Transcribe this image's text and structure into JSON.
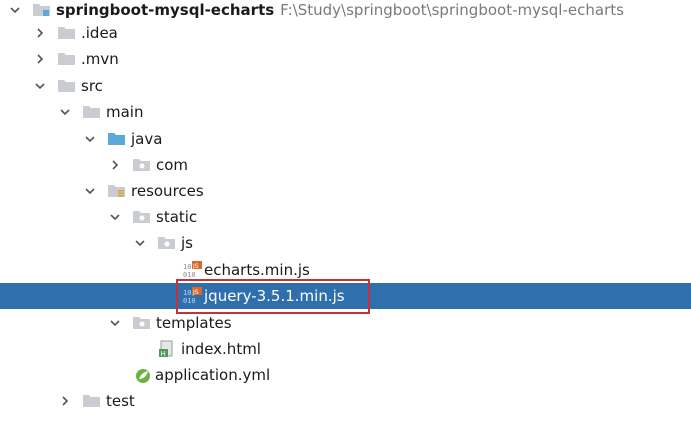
{
  "project_tree": {
    "root": {
      "name": "springboot-mysql-echarts",
      "path": "F:\\Study\\springboot\\springboot-mysql-echarts",
      "icon": "module-folder-icon",
      "expanded": true
    },
    "items": [
      {
        "label": "idea_folder",
        "name": ".idea",
        "icon": "folder-icon",
        "arrow": "collapsed"
      },
      {
        "label": "mvn_folder",
        "name": ".mvn",
        "icon": "folder-icon",
        "arrow": "collapsed"
      },
      {
        "label": "src_folder",
        "name": "src",
        "icon": "folder-icon",
        "arrow": "expanded"
      },
      {
        "label": "main_folder",
        "name": "main",
        "icon": "folder-icon",
        "arrow": "expanded"
      },
      {
        "label": "java_folder",
        "name": "java",
        "icon": "source-root-folder-icon",
        "arrow": "expanded"
      },
      {
        "label": "com_package",
        "name": "com",
        "icon": "package-icon",
        "arrow": "collapsed"
      },
      {
        "label": "resources_folder",
        "name": "resources",
        "icon": "resources-folder-icon",
        "arrow": "expanded"
      },
      {
        "label": "static_folder",
        "name": "static",
        "icon": "package-icon",
        "arrow": "expanded"
      },
      {
        "label": "js_folder",
        "name": "js",
        "icon": "package-icon",
        "arrow": "expanded"
      },
      {
        "label": "echarts_file",
        "name": "echarts.min.js",
        "icon": "minified-js-file-icon",
        "arrow": "none"
      },
      {
        "label": "jquery_file",
        "name": "jquery-3.5.1.min.js",
        "icon": "minified-js-file-icon",
        "arrow": "none",
        "selected": true
      },
      {
        "label": "templates_folder",
        "name": "templates",
        "icon": "package-icon",
        "arrow": "expanded"
      },
      {
        "label": "index_file",
        "name": "index.html",
        "icon": "html-file-icon",
        "arrow": "none"
      },
      {
        "label": "application_file",
        "name": "application.yml",
        "icon": "spring-config-icon",
        "arrow": "none"
      },
      {
        "label": "test_folder",
        "name": "test",
        "icon": "folder-icon",
        "arrow": "collapsed"
      }
    ]
  },
  "colors": {
    "selection": "#2f6fae",
    "highlight_border": "#c8303a",
    "folder": "#c9cdd2",
    "source_folder": "#5aa9d6",
    "path_text": "#7a7a7a",
    "js_badge": "#d66a2e"
  }
}
